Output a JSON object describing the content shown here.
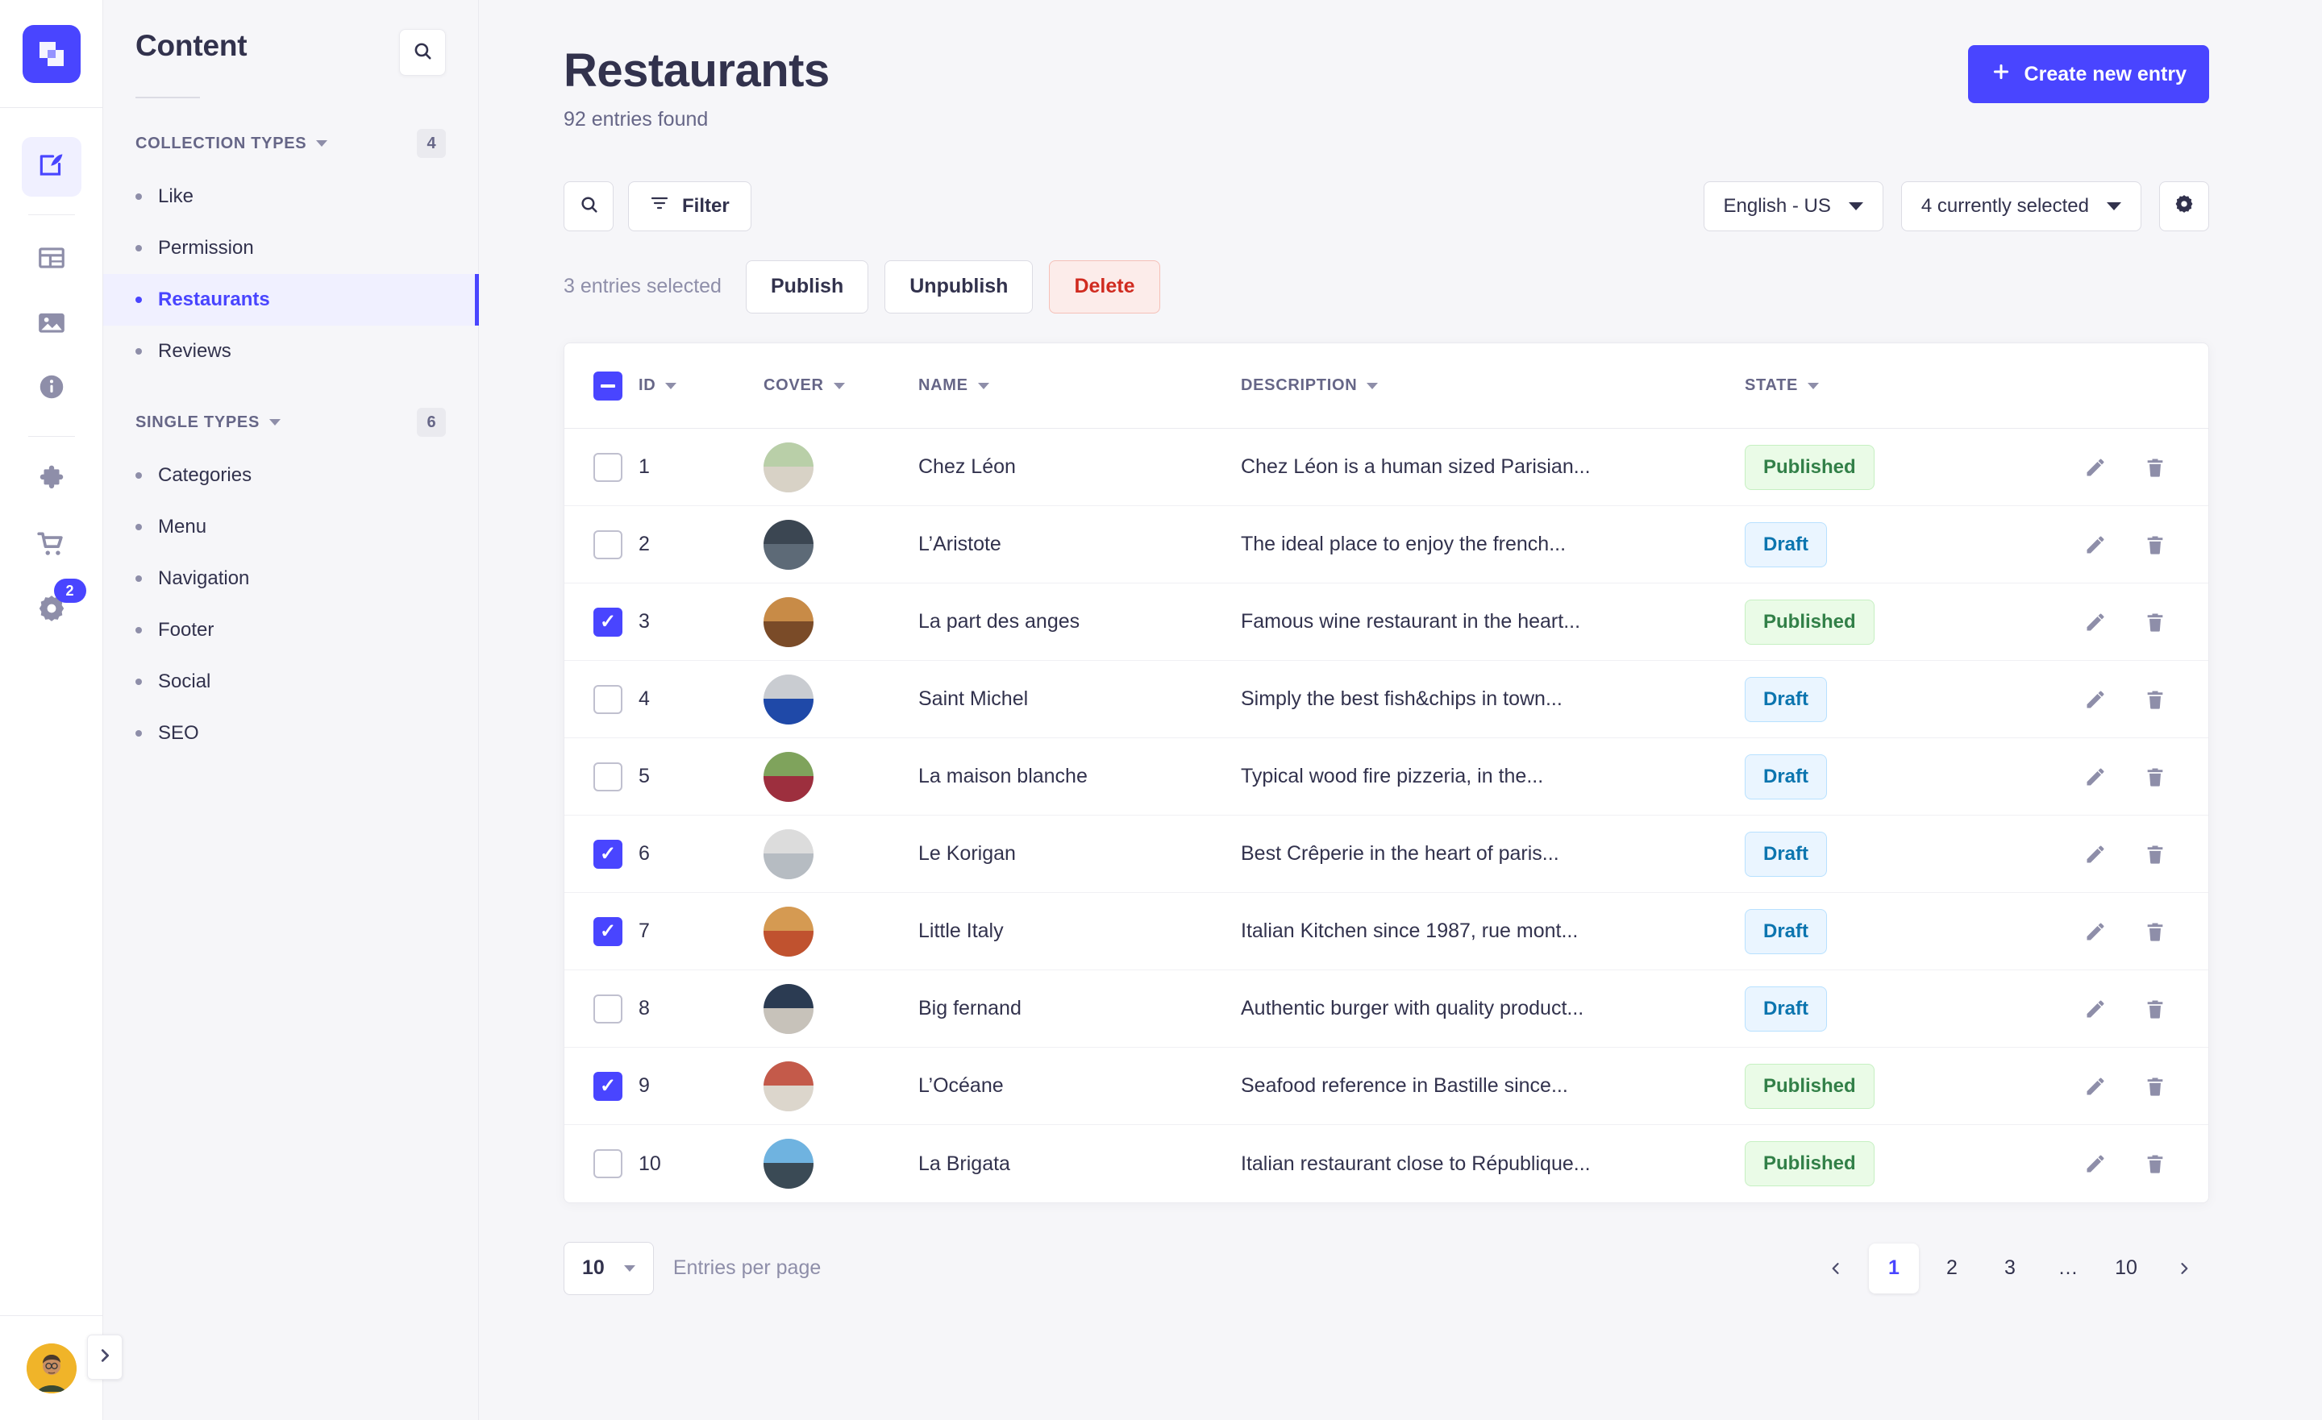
{
  "rail": {
    "logo_icon": "strapi-logo-icon",
    "items": [
      {
        "icon": "content-manager-pen-icon",
        "name": "content-manager",
        "active": true
      },
      {
        "icon": "content-type-builder-layout-icon",
        "name": "content-type-builder",
        "active": false
      },
      {
        "icon": "media-library-image-icon",
        "name": "media-library",
        "active": false
      },
      {
        "icon": "documentation-info-icon",
        "name": "documentation",
        "active": false
      },
      {
        "icon": "plugins-puzzle-icon",
        "name": "plugins",
        "active": false
      },
      {
        "icon": "marketplace-cart-icon",
        "name": "marketplace",
        "active": false
      },
      {
        "icon": "settings-gear-icon",
        "name": "settings",
        "active": false,
        "badge": "2"
      }
    ],
    "avatar_icon": "user-avatar",
    "expand_icon": "chevron-right-icon"
  },
  "sidebar": {
    "title": "Content",
    "search_icon": "search-icon",
    "groups": [
      {
        "label": "COLLECTION TYPES",
        "count": "4",
        "items": [
          {
            "label": "Like",
            "active": false
          },
          {
            "label": "Permission",
            "active": false
          },
          {
            "label": "Restaurants",
            "active": true
          },
          {
            "label": "Reviews",
            "active": false
          }
        ]
      },
      {
        "label": "SINGLE TYPES",
        "count": "6",
        "items": [
          {
            "label": "Categories",
            "active": false
          },
          {
            "label": "Menu",
            "active": false
          },
          {
            "label": "Navigation",
            "active": false
          },
          {
            "label": "Footer",
            "active": false
          },
          {
            "label": "Social",
            "active": false
          },
          {
            "label": "SEO",
            "active": false
          }
        ]
      }
    ]
  },
  "header": {
    "title": "Restaurants",
    "subtitle": "92 entries found",
    "create_button": "Create new entry",
    "create_icon": "plus-icon"
  },
  "toolbar": {
    "search_icon": "search-icon",
    "filter_label": "Filter",
    "filter_icon": "filter-icon",
    "locale_value": "English - US",
    "fields_value": "4 currently selected",
    "settings_icon": "gear-icon"
  },
  "bulk": {
    "selected_label": "3 entries selected",
    "publish_label": "Publish",
    "unpublish_label": "Unpublish",
    "delete_label": "Delete"
  },
  "table": {
    "select_all_state": "indeterminate",
    "columns": [
      {
        "label": "ID",
        "key": "id"
      },
      {
        "label": "COVER",
        "key": "cover"
      },
      {
        "label": "NAME",
        "key": "name"
      },
      {
        "label": "DESCRIPTION",
        "key": "description"
      },
      {
        "label": "STATE",
        "key": "state"
      }
    ],
    "sort_icon": "caret-down-icon",
    "edit_icon": "pencil-icon",
    "delete_icon": "trash-icon",
    "rows": [
      {
        "checked": false,
        "id": "1",
        "name": "Chez Léon",
        "description": "Chez Léon is a human sized Parisian...",
        "state": "Published",
        "thumb_sky": "#b9cfa8",
        "thumb_ground": "#d8d2c6"
      },
      {
        "checked": false,
        "id": "2",
        "name": "L’Aristote",
        "description": "The ideal place to enjoy the french...",
        "state": "Draft",
        "thumb_sky": "#3b4652",
        "thumb_ground": "#5d6a77"
      },
      {
        "checked": true,
        "id": "3",
        "name": "La part des anges",
        "description": "Famous wine restaurant in the heart...",
        "state": "Published",
        "thumb_sky": "#c88b47",
        "thumb_ground": "#7a4b28"
      },
      {
        "checked": false,
        "id": "4",
        "name": "Saint Michel",
        "description": "Simply the best fish&chips in town...",
        "state": "Draft",
        "thumb_sky": "#c9ccd1",
        "thumb_ground": "#1f49a8"
      },
      {
        "checked": false,
        "id": "5",
        "name": "La maison blanche",
        "description": "Typical wood fire pizzeria, in the...",
        "state": "Draft",
        "thumb_sky": "#7fa35c",
        "thumb_ground": "#9d2f3e"
      },
      {
        "checked": true,
        "id": "6",
        "name": "Le Korigan",
        "description": "Best Crêperie in the heart of paris...",
        "state": "Draft",
        "thumb_sky": "#dcdcdc",
        "thumb_ground": "#b6bcc2"
      },
      {
        "checked": true,
        "id": "7",
        "name": "Little Italy",
        "description": "Italian Kitchen since 1987, rue mont...",
        "state": "Draft",
        "thumb_sky": "#d59a52",
        "thumb_ground": "#c0522f"
      },
      {
        "checked": false,
        "id": "8",
        "name": "Big fernand",
        "description": "Authentic burger with quality product...",
        "state": "Draft",
        "thumb_sky": "#2b3b52",
        "thumb_ground": "#c7c2ba"
      },
      {
        "checked": true,
        "id": "9",
        "name": "L’Océane",
        "description": "Seafood reference in Bastille since...",
        "state": "Published",
        "thumb_sky": "#c45a4a",
        "thumb_ground": "#dcd6cc"
      },
      {
        "checked": false,
        "id": "10",
        "name": "La Brigata",
        "description": "Italian restaurant close to République...",
        "state": "Published",
        "thumb_sky": "#6fb3e0",
        "thumb_ground": "#3a4a55"
      }
    ]
  },
  "footer": {
    "per_page_value": "10",
    "per_page_label": "Entries per page",
    "prev_icon": "chevron-left-icon",
    "next_icon": "chevron-right-icon",
    "pages": [
      "1",
      "2",
      "3",
      "…",
      "10"
    ],
    "current_page": "1"
  }
}
